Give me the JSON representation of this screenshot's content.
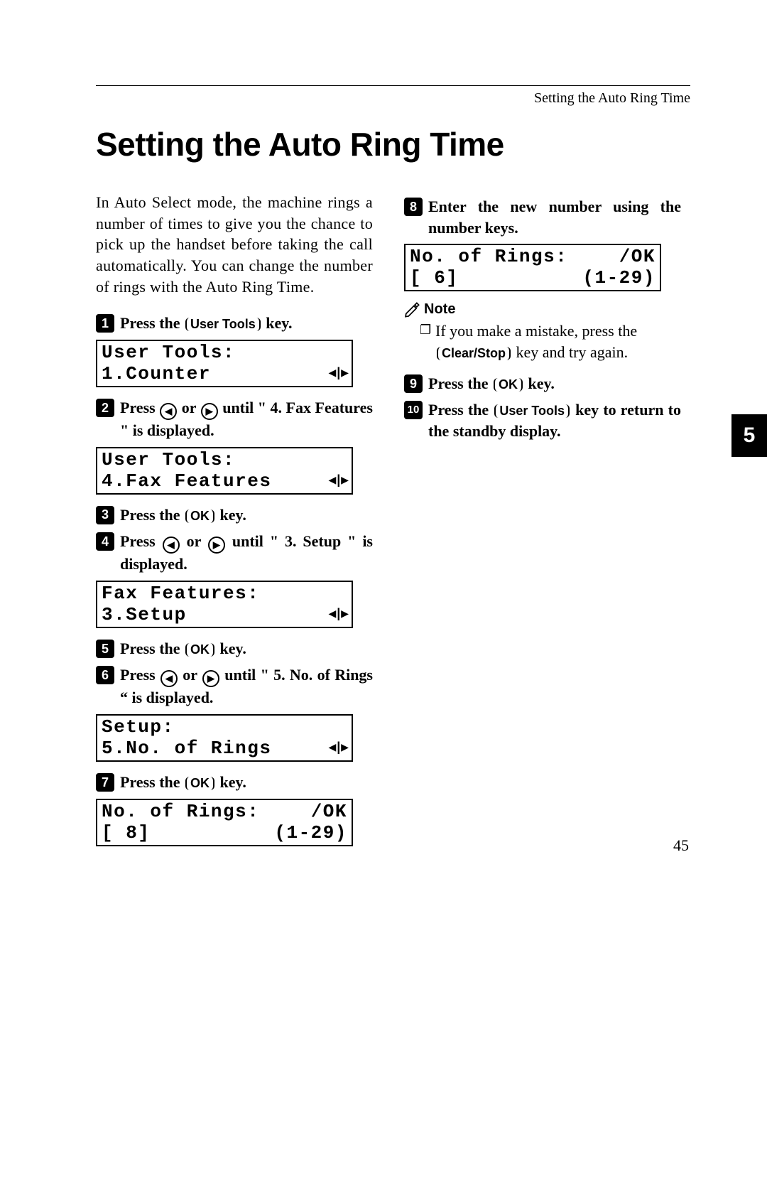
{
  "header": {
    "running_title": "Setting the Auto Ring Time"
  },
  "title": "Setting the Auto Ring Time",
  "side_tab": "5",
  "page_number": "45",
  "intro": "In Auto Select mode, the machine rings a number of times to give you the chance to pick up the handset before taking the call automatically. You can change the number of rings with the Auto Ring Time.",
  "keys": {
    "user_tools": "User Tools",
    "ok": "OK",
    "clear_stop": "Clear/Stop"
  },
  "steps": {
    "s1_a": "Press the ",
    "s1_b": " key.",
    "s2_a": "Press ",
    "s2_b": " or ",
    "s2_c": " until \" 4. Fax Features \" is displayed.",
    "s3_a": "Press the ",
    "s3_b": " key.",
    "s4_a": "Press ",
    "s4_b": " or ",
    "s4_c": " until \" 3. Setup \" is displayed.",
    "s5_a": "Press the ",
    "s5_b": " key.",
    "s6_a": "Press ",
    "s6_b": " or ",
    "s6_c": " until \" 5. No. of Rings “ is displayed.",
    "s7_a": "Press the ",
    "s7_b": " key.",
    "s8": "Enter the new number using the number keys.",
    "s9_a": "Press the ",
    "s9_b": " key.",
    "s10_a": "Press the ",
    "s10_b": " key to return to the standby display."
  },
  "note": {
    "heading": "Note",
    "item_a": "If you make a mistake, press the ",
    "item_b": " key and try again."
  },
  "lcd": {
    "d1": {
      "l1": "User Tools:",
      "l2": "1.Counter"
    },
    "d2": {
      "l1": "User Tools:",
      "l2": "4.Fax Features"
    },
    "d3": {
      "l1": "Fax Features:",
      "l2": "3.Setup"
    },
    "d4": {
      "l1": "Setup:",
      "l2": "5.No. of Rings"
    },
    "d5": {
      "l1a": "No. of Rings:",
      "l1b": "/OK",
      "l2a": "[ 8]",
      "l2b": "(1-29)"
    },
    "d6": {
      "l1a": "No. of Rings:",
      "l1b": "/OK",
      "l2a": "[ 6]",
      "l2b": "(1-29)"
    },
    "nav": "◀|▶"
  }
}
